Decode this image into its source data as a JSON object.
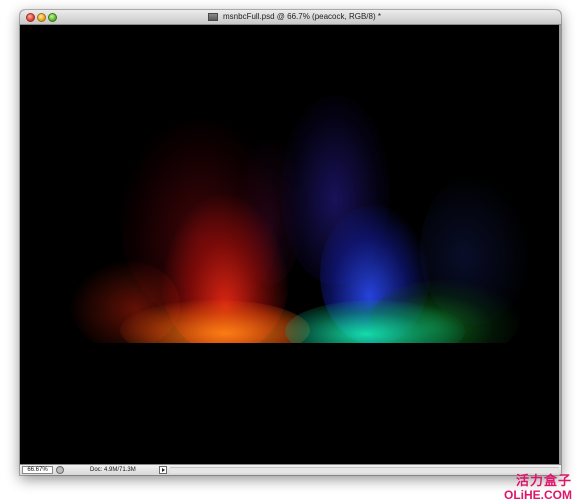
{
  "window": {
    "title": "msnbcFull.psd @ 66.7% (peacock, RGB/8) *"
  },
  "statusbar": {
    "zoom_value": "66.67%",
    "doc_info": "Doc: 4.9M/71.3M"
  },
  "watermark": {
    "chinese": "活力盒子",
    "site": "OLiHE.COM",
    "color": "#e0156a"
  },
  "icons": {
    "close": "close-icon",
    "minimize": "minimize-icon",
    "zoom": "zoom-icon",
    "document": "psd-document-icon",
    "quick_mask": "quick-mask-icon",
    "status_menu": "triangle-right-icon"
  },
  "colors": {
    "canvas_background": "#000000",
    "glow_colors": [
      "#e62814",
      "#ff8214",
      "#2846e6",
      "#14e6aa",
      "#149628"
    ]
  }
}
